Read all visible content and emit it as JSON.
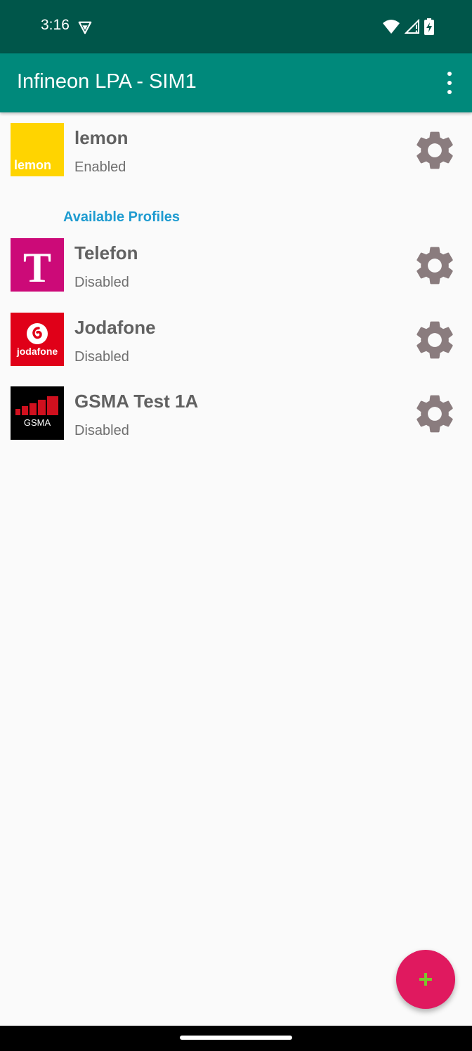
{
  "status_bar": {
    "time": "3:16",
    "icons": [
      "vpn-key-icon",
      "wifi-icon",
      "cellular-signal-icon",
      "battery-charging-icon"
    ]
  },
  "app_bar": {
    "title": "Infineon LPA - SIM1",
    "menu_icon": "more-vert-icon"
  },
  "active_profile": {
    "name": "lemon",
    "status": "Enabled",
    "logo_text": "lemon",
    "logo_color": "#ffd400"
  },
  "section": {
    "available_label": "Available Profiles"
  },
  "available_profiles": [
    {
      "name": "Telefon",
      "status": "Disabled",
      "logo_text": "T",
      "logo_color": "#cc0a78"
    },
    {
      "name": "Jodafone",
      "status": "Disabled",
      "logo_text": "jodafone",
      "logo_color": "#e00018"
    },
    {
      "name": "GSMA Test 1A",
      "status": "Disabled",
      "logo_text": "GSMA",
      "logo_color": "#000000"
    }
  ],
  "icons": {
    "settings": "gear-icon",
    "add": "plus-icon"
  },
  "colors": {
    "primary": "#00897b",
    "primary_dark": "#00564a",
    "accent": "#e0195f",
    "section_header": "#1e9bd0",
    "gear": "#8a7c7e",
    "fab_plus": "#7bc62d"
  }
}
